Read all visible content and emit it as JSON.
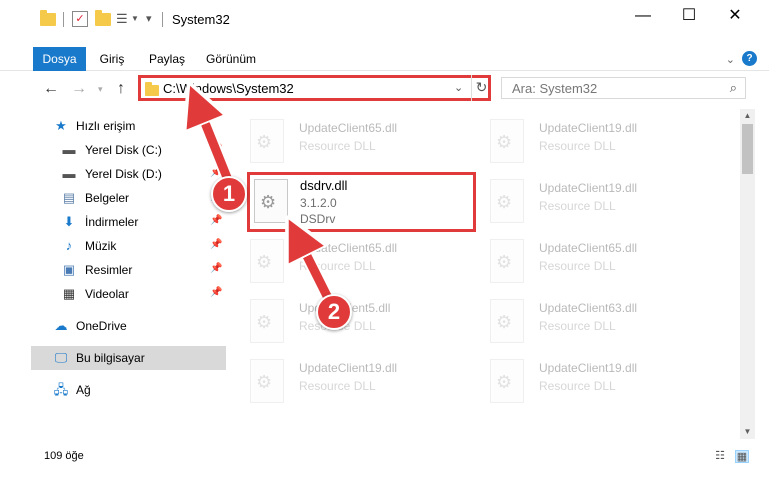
{
  "window": {
    "title": "System32",
    "minimize": "—",
    "maximize": "☐",
    "close": "✕"
  },
  "ribbon": {
    "tabs": [
      "Dosya",
      "Giriş",
      "Paylaş",
      "Görünüm"
    ],
    "accent": "#1979ca"
  },
  "nav": {
    "address": "C:\\Windows\\System32",
    "search_placeholder": "Ara: System32"
  },
  "sidebar": {
    "items": [
      {
        "label": "Hızlı erişim",
        "icon": "star-icon"
      },
      {
        "label": "Yerel Disk (C:)",
        "icon": "drive-icon"
      },
      {
        "label": "Yerel Disk (D:)",
        "icon": "drive-icon"
      },
      {
        "label": "Belgeler",
        "icon": "documents-icon"
      },
      {
        "label": "İndirmeler",
        "icon": "download-icon"
      },
      {
        "label": "Müzik",
        "icon": "music-icon"
      },
      {
        "label": "Resimler",
        "icon": "pictures-icon"
      },
      {
        "label": "Videolar",
        "icon": "videos-icon"
      },
      {
        "label": "OneDrive",
        "icon": "cloud-icon"
      },
      {
        "label": "Bu bilgisayar",
        "icon": "computer-icon"
      },
      {
        "label": "Ağ",
        "icon": "network-icon"
      }
    ]
  },
  "files": {
    "highlighted": {
      "name": "dsdrv.dll",
      "version": "3.1.2.0",
      "description": "DSDrv"
    },
    "background": [
      {
        "name": "UpdateClient65.dll",
        "type": "Resource DLL"
      },
      {
        "name": "UpdateClient19.dll",
        "type": "Resource DLL"
      },
      {
        "name": "UpdateClient19.dll",
        "type": "Resource DLL"
      },
      {
        "name": "UpdateClient65.dll",
        "type": "Resource DLL"
      },
      {
        "name": "UpdateClient65.dll",
        "type": "Resource DLL"
      },
      {
        "name": "UpdateClient5.dll",
        "type": "Resource DLL"
      },
      {
        "name": "UpdateClient63.dll",
        "type": "Resource DLL"
      },
      {
        "name": "UpdateClient19.dll",
        "type": "Resource DLL"
      },
      {
        "name": "UpdateClient19.dll",
        "type": "Resource DLL"
      }
    ]
  },
  "status": {
    "count": "109 öğe"
  },
  "annotations": {
    "step1": "1",
    "step2": "2",
    "color": "#e03a3a"
  }
}
